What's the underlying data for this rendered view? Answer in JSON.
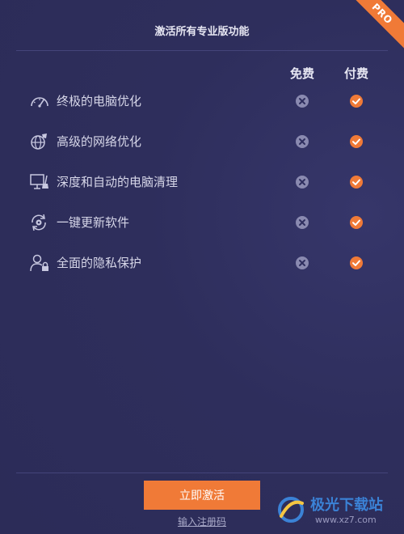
{
  "header": {
    "title": "激活所有专业版功能",
    "badge": "PRO"
  },
  "columns": {
    "free": "免费",
    "paid": "付费"
  },
  "features": [
    {
      "label": "终极的电脑优化",
      "icon": "speedometer-icon",
      "free": false,
      "paid": true
    },
    {
      "label": "高级的网络优化",
      "icon": "rocket-globe-icon",
      "free": false,
      "paid": true
    },
    {
      "label": "深度和自动的电脑清理",
      "icon": "monitor-broom-icon",
      "free": false,
      "paid": true
    },
    {
      "label": "一键更新软件",
      "icon": "gear-refresh-icon",
      "free": false,
      "paid": true
    },
    {
      "label": "全面的隐私保护",
      "icon": "user-lock-icon",
      "free": false,
      "paid": true
    }
  ],
  "actions": {
    "activate": "立即激活",
    "register": "输入注册码"
  },
  "watermark": {
    "text": "极光下载站",
    "url": "www.xz7.com"
  },
  "colors": {
    "background": "#2f2f5e",
    "accent": "#f07a37",
    "unavailable": "#8a8ab0",
    "text": "#d6d6e8"
  }
}
